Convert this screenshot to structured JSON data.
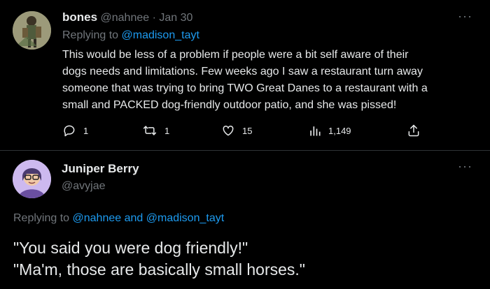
{
  "reply1": {
    "display_name": "bones",
    "handle": "@nahnee",
    "separator": "·",
    "date": "Jan 30",
    "replying_prefix": "Replying to",
    "replying_to": "@madison_tayt",
    "text_lines": [
      "This would be less of a problem if people were a bit self aware of their",
      "dogs needs and limitations. Few weeks ago I saw a restaurant turn away",
      "someone that was trying to bring TWO Great Danes to a restaurant with a",
      "small and PACKED dog-friendly outdoor patio, and she was pissed!"
    ],
    "stats": {
      "replies": "1",
      "retweets": "1",
      "likes": "15",
      "views": "1,149"
    },
    "more_icon": "ellipsis-icon"
  },
  "reply2": {
    "display_name": "Juniper Berry",
    "handle": "@avyjae",
    "replying_prefix": "Replying to",
    "replying_to_1": "@nahnee",
    "replying_and": "and",
    "replying_to_2": "@madison_tayt",
    "text_lines": [
      "\"You said you were dog friendly!\"",
      "\"Ma'm, those are basically small horses.\""
    ]
  },
  "colors": {
    "background": "#000000",
    "text": "#e7e9ea",
    "muted": "#71767b",
    "link": "#1d9bf0",
    "divider": "#2f3336"
  },
  "icons": [
    "reply-icon",
    "retweet-icon",
    "like-icon",
    "views-icon",
    "share-icon",
    "ellipsis-icon"
  ]
}
